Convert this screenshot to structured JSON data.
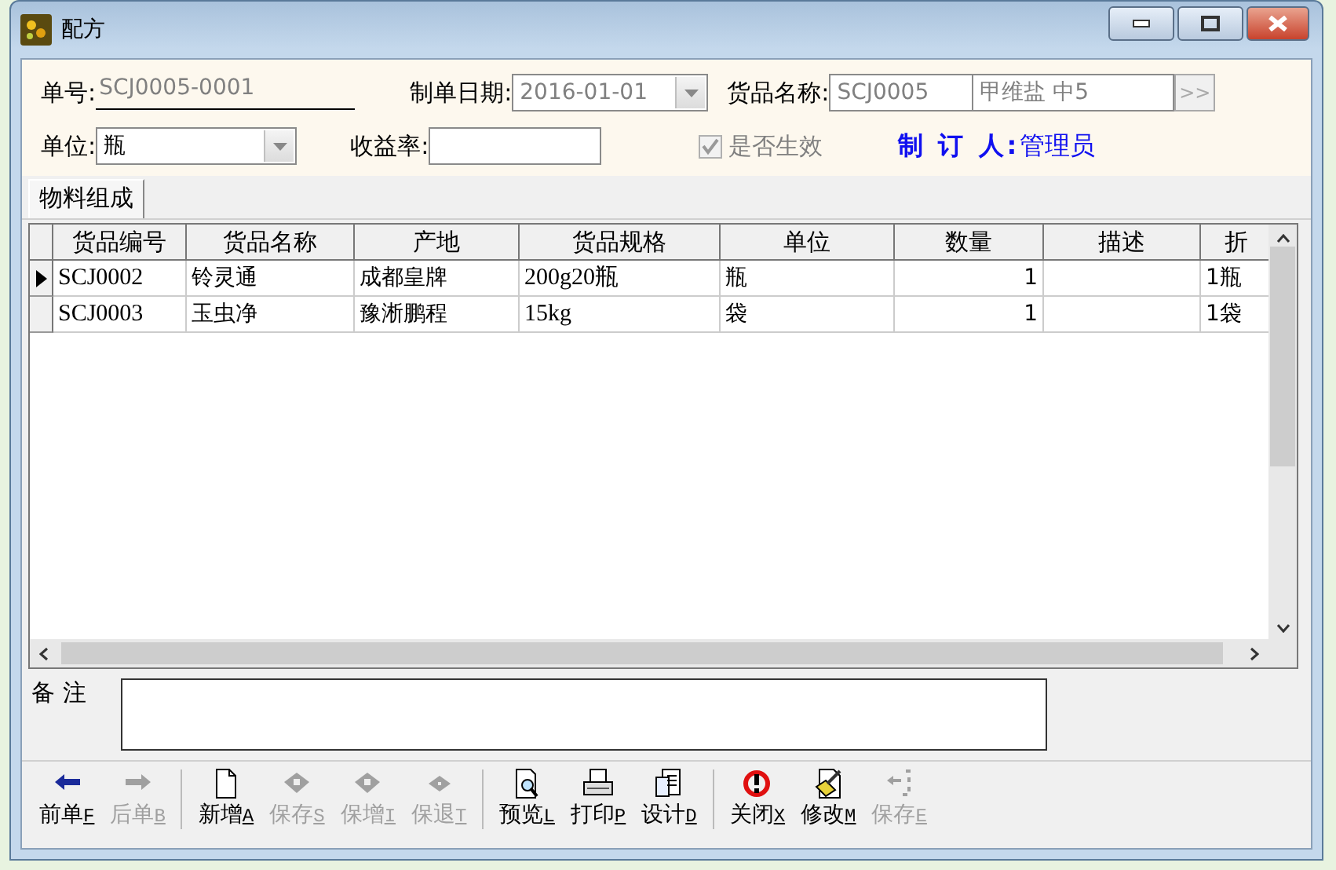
{
  "window": {
    "title": "配方"
  },
  "form": {
    "order_no": {
      "label": "单号:",
      "value": "SCJ0005-0001"
    },
    "date": {
      "label": "制单日期:",
      "value": "2016-01-01",
      "disabled": true
    },
    "goods": {
      "label": "货品名称:",
      "code": "SCJ0005",
      "name": "甲维盐 中5",
      "button": ">>"
    },
    "unit": {
      "label": "单位:",
      "value": "瓶"
    },
    "yield": {
      "label": "收益率:"
    },
    "effective": {
      "label": "是否生效",
      "checked": true,
      "disabled": true
    },
    "maker": {
      "label": "制 订 人:",
      "value": "管理员"
    }
  },
  "tabs": [
    {
      "label": "物料组成",
      "selected": true
    }
  ],
  "table": {
    "columns": [
      "货品编号",
      "货品名称",
      "产地",
      "货品规格",
      "单位",
      "数量",
      "描述",
      "折"
    ],
    "rows": [
      {
        "selected": true,
        "cells": [
          "SCJ0002",
          "铃灵通",
          "成都皇牌",
          "200g20瓶",
          "瓶",
          "1",
          "",
          "1瓶"
        ]
      },
      {
        "selected": false,
        "cells": [
          "SCJ0003",
          "玉虫净",
          "豫淅鹏程",
          "15kg",
          "袋",
          "1",
          "",
          "1袋"
        ]
      }
    ]
  },
  "remark": {
    "label": "备 注"
  },
  "toolbar": [
    {
      "label": "前单",
      "key": "F",
      "kind": "back",
      "disabled": false
    },
    {
      "label": "后单",
      "key": "B",
      "kind": "forward",
      "disabled": true
    },
    {
      "kind": "separator"
    },
    {
      "label": "新增",
      "key": "A",
      "kind": "new",
      "disabled": false
    },
    {
      "label": "保存",
      "key": "S",
      "kind": "save",
      "disabled": true
    },
    {
      "label": "保增",
      "key": "I",
      "kind": "save",
      "disabled": true
    },
    {
      "label": "保退",
      "key": "T",
      "kind": "diamond",
      "disabled": true
    },
    {
      "kind": "separator"
    },
    {
      "label": "预览",
      "key": "L",
      "kind": "preview",
      "disabled": false
    },
    {
      "label": "打印",
      "key": "P",
      "kind": "print",
      "disabled": false
    },
    {
      "label": "设计",
      "key": "D",
      "kind": "design",
      "disabled": false
    },
    {
      "kind": "separator"
    },
    {
      "label": "关闭",
      "key": "X",
      "kind": "close",
      "disabled": false
    },
    {
      "label": "修改",
      "key": "M",
      "kind": "edit",
      "disabled": false
    },
    {
      "label": "保存",
      "key": "E",
      "kind": "undo",
      "disabled": true
    }
  ]
}
